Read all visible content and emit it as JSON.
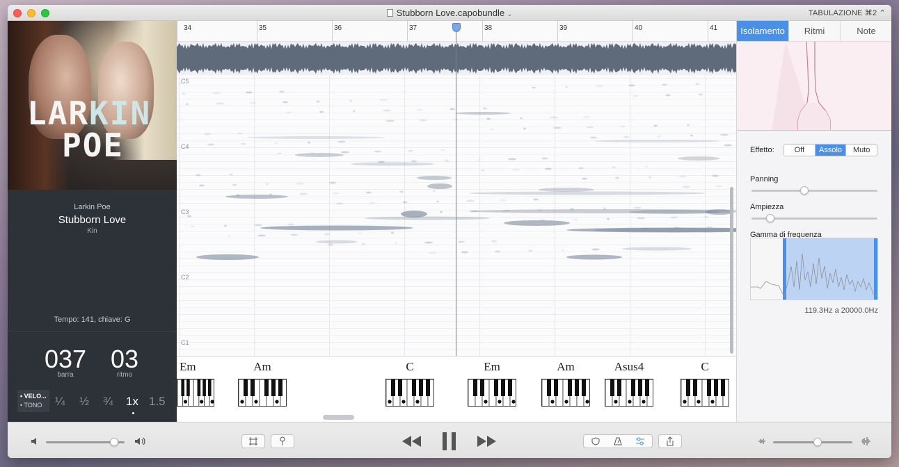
{
  "window": {
    "title": "Stubborn Love.capobundle",
    "mode": "TABULAZIONE ⌘2 ⌃"
  },
  "album": {
    "logo_line1_a": "LAR",
    "logo_line1_b": "KIN",
    "logo_line2": "POE"
  },
  "track": {
    "artist": "Larkin Poe",
    "title": "Stubborn Love",
    "album": "Kin",
    "tempo_key": "Tempo: 141, chiave: G"
  },
  "position": {
    "bar": "037",
    "bar_label": "barra",
    "beat": "03",
    "beat_label": "ritmo"
  },
  "speed": {
    "toggle_velocity": "• VELO...",
    "toggle_pitch": "• TONO",
    "options": [
      "¼",
      "½",
      "¾",
      "1x",
      "1.5"
    ],
    "selected": "1x"
  },
  "ruler": {
    "bars": [
      "34",
      "35",
      "36",
      "37",
      "38",
      "39",
      "40",
      "41"
    ]
  },
  "notes": [
    "C5",
    "C4",
    "C3",
    "C2",
    "C1"
  ],
  "chords": [
    "Em",
    "Am",
    "C",
    "Em",
    "Am",
    "Asus4",
    "C"
  ],
  "right_panel": {
    "tabs": [
      "Isolamento",
      "Ritmi",
      "Note"
    ],
    "active_tab": "Isolamento",
    "effect_label": "Effetto:",
    "effect_options": [
      "Off",
      "Assolo",
      "Muto"
    ],
    "effect_selected": "Assolo",
    "panning_label": "Panning",
    "panning_value": 0.42,
    "width_label": "Ampiezza",
    "width_value": 0.15,
    "freq_label": "Gamma di frequenza",
    "freq_range_text": "119.3Hz a 20000.0Hz"
  },
  "toolbar": {
    "volume_value": 0.87,
    "output_value": 0.56
  },
  "colors": {
    "accent": "#4a90e8",
    "playhead": "#4a86d8",
    "waveform": "#5f6b7a",
    "sidebar": "#2d3138"
  }
}
